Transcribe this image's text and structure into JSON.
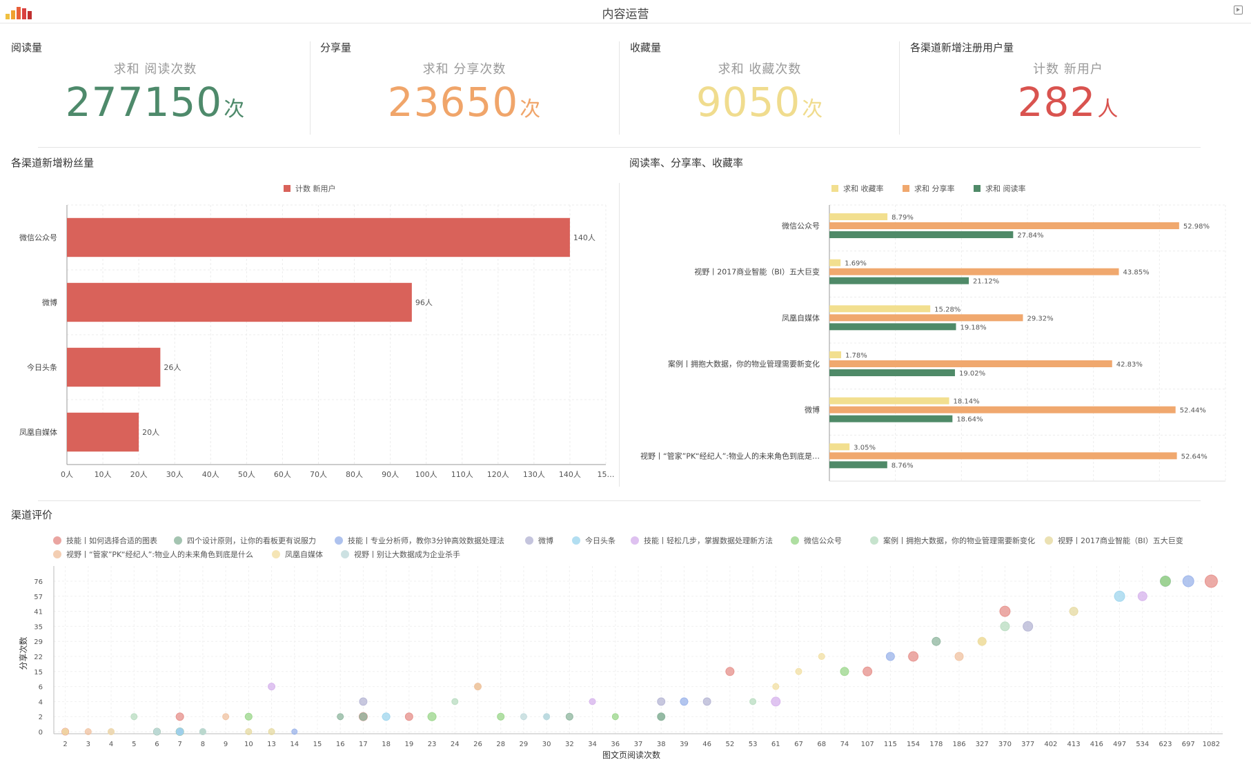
{
  "header": {
    "title": "内容运营"
  },
  "kpis": [
    {
      "label": "阅读量",
      "sub": "求和 阅读次数",
      "value": "277150",
      "unit": "次",
      "color": "#4e8a6b"
    },
    {
      "label": "分享量",
      "sub": "求和 分享次数",
      "value": "23650",
      "unit": "次",
      "color": "#f0a56a"
    },
    {
      "label": "收藏量",
      "sub": "求和 收藏次数",
      "value": "9050",
      "unit": "次",
      "color": "#f0dc8e"
    },
    {
      "label": "各渠道新增注册用户量",
      "sub": "计数 新用户",
      "value": "282",
      "unit": "人",
      "color": "#d9534f"
    }
  ],
  "sections": {
    "fans": "各渠道新增粉丝量",
    "rates": "阅读率、分享率、收藏率",
    "eval": "渠道评价"
  },
  "chart_data": [
    {
      "type": "bar",
      "orientation": "horizontal",
      "title": "各渠道新增粉丝量",
      "legend": [
        "计数 新用户"
      ],
      "color": "#d9625a",
      "categories": [
        "微信公众号",
        "微博",
        "今日头条",
        "凤凰自媒体"
      ],
      "values": [
        140,
        96,
        26,
        20
      ],
      "value_labels": [
        "140人",
        "96人",
        "26人",
        "20人"
      ],
      "xticks": [
        "0人",
        "10人",
        "20人",
        "30人",
        "40人",
        "50人",
        "60人",
        "70人",
        "80人",
        "90人",
        "100人",
        "110人",
        "120人",
        "130人",
        "140人",
        "15…"
      ],
      "xlim": [
        0,
        150
      ]
    },
    {
      "type": "bar",
      "orientation": "horizontal",
      "title": "阅读率、分享率、收藏率",
      "categories": [
        "微信公众号",
        "视野丨2017商业智能（BI）五大巨变",
        "凤凰自媒体",
        "案例丨拥抱大数据，你的物业管理需要新变化",
        "微博",
        "视野丨“管家”PK“经纪人”:物业人的未来角色到底是…"
      ],
      "series": [
        {
          "name": "求和 收藏率",
          "color": "#f2df8f",
          "values": [
            8.79,
            1.69,
            15.28,
            1.78,
            18.14,
            3.05
          ],
          "labels": [
            "8.79%",
            "1.69%",
            "15.28%",
            "1.78%",
            "18.14%",
            "3.05%"
          ]
        },
        {
          "name": "求和 分享率",
          "color": "#f0a86e",
          "values": [
            52.98,
            43.85,
            29.32,
            42.83,
            52.44,
            52.64
          ],
          "labels": [
            "52.98%",
            "43.85%",
            "29.32%",
            "42.83%",
            "52.44%",
            "52.64%"
          ]
        },
        {
          "name": "求和 阅读率",
          "color": "#4f8a68",
          "values": [
            27.84,
            21.12,
            19.18,
            19.02,
            18.64,
            8.76
          ],
          "labels": [
            "27.84%",
            "21.12%",
            "19.18%",
            "19.02%",
            "18.64%",
            "8.76%"
          ]
        }
      ],
      "xlim": [
        0,
        60
      ]
    },
    {
      "type": "scatter",
      "title": "渠道评价",
      "xlabel": "图文页阅读次数",
      "ylabel": "分享次数",
      "xcategories": [
        "2",
        "3",
        "4",
        "5",
        "6",
        "7",
        "8",
        "9",
        "10",
        "13",
        "14",
        "15",
        "16",
        "17",
        "18",
        "19",
        "23",
        "24",
        "26",
        "28",
        "29",
        "30",
        "32",
        "34",
        "36",
        "37",
        "38",
        "39",
        "46",
        "52",
        "53",
        "61",
        "67",
        "68",
        "74",
        "107",
        "115",
        "154",
        "178",
        "186",
        "327",
        "370",
        "377",
        "402",
        "413",
        "416",
        "497",
        "534",
        "623",
        "697",
        "1082"
      ],
      "ycategories": [
        "0",
        "2",
        "4",
        "6",
        "15",
        "22",
        "29",
        "35",
        "41",
        "57",
        "76"
      ],
      "series": [
        {
          "name": "技能丨如何选择合适的图表",
          "color": "#e58f8a",
          "points": [
            [
              0,
              0,
              8
            ],
            [
              5,
              1,
              9
            ],
            [
              13,
              1,
              10
            ],
            [
              15,
              1,
              9
            ],
            [
              29,
              4,
              10
            ],
            [
              35,
              4,
              11
            ],
            [
              37,
              5,
              12
            ],
            [
              41,
              8,
              13
            ],
            [
              50,
              10,
              16
            ]
          ]
        },
        {
          "name": "四个设计原则，让你的看板更有说服力",
          "color": "#8db59d",
          "points": [
            [
              4,
              0,
              8
            ],
            [
              5,
              0,
              9
            ],
            [
              12,
              1,
              7
            ],
            [
              13,
              1,
              9
            ],
            [
              22,
              1,
              8
            ],
            [
              26,
              1,
              9
            ],
            [
              26,
              1,
              8
            ],
            [
              38,
              6,
              10
            ],
            [
              48,
              10,
              13
            ]
          ]
        },
        {
          "name": "技能丨专业分析师，教你3分钟高效数据处理法",
          "color": "#9ab3ea",
          "points": [
            [
              5,
              0,
              7
            ],
            [
              10,
              0,
              6
            ],
            [
              27,
              2,
              9
            ],
            [
              36,
              5,
              10
            ],
            [
              49,
              10,
              14
            ]
          ]
        },
        {
          "name": "微博",
          "color": "#b5b5d4",
          "points": [
            [
              13,
              2,
              9
            ],
            [
              26,
              2,
              9
            ],
            [
              28,
              2,
              9
            ],
            [
              42,
              7,
              12
            ]
          ]
        },
        {
          "name": "今日头条",
          "color": "#9fd6ee",
          "points": [
            [
              5,
              0,
              8
            ],
            [
              14,
              1,
              9
            ],
            [
              21,
              1,
              7
            ],
            [
              46,
              9,
              13
            ]
          ]
        },
        {
          "name": "技能丨轻松几步，掌握数据处理新方法",
          "color": "#d6b2ec",
          "points": [
            [
              2,
              0,
              7
            ],
            [
              6,
              0,
              7
            ],
            [
              9,
              3,
              8
            ],
            [
              23,
              2,
              7
            ],
            [
              31,
              2,
              11
            ],
            [
              47,
              9,
              11
            ]
          ]
        },
        {
          "name": "微信公众号",
          "color": "#9ad68a",
          "points": [
            [
              6,
              0,
              7
            ],
            [
              8,
              1,
              8
            ],
            [
              16,
              1,
              10
            ],
            [
              19,
              1,
              8
            ],
            [
              24,
              1,
              7
            ],
            [
              34,
              4,
              10
            ],
            [
              48,
              10,
              12
            ]
          ]
        },
        {
          "name": "案例丨拥抱大数据，你的物业管理需要新变化",
          "color": "#b8dcc0",
          "points": [
            [
              3,
              1,
              7
            ],
            [
              4,
              0,
              7
            ],
            [
              17,
              2,
              7
            ],
            [
              30,
              2,
              7
            ],
            [
              41,
              7,
              11
            ]
          ]
        },
        {
          "name": "视野丨2017商业智能（BI）五大巨变",
          "color": "#e6d9a0",
          "points": [
            [
              8,
              0,
              7
            ],
            [
              9,
              0,
              7
            ],
            [
              18,
              3,
              7
            ],
            [
              40,
              6,
              10
            ],
            [
              44,
              8,
              10
            ]
          ]
        },
        {
          "name": "视野丨“管家”PK“经纪人”:物业人的未来角色到底是什么",
          "color": "#f0c2a0",
          "points": [
            [
              1,
              0,
              7
            ],
            [
              7,
              1,
              7
            ],
            [
              18,
              3,
              8
            ],
            [
              39,
              5,
              10
            ]
          ]
        },
        {
          "name": "凤凰自媒体",
          "color": "#f2dfa2",
          "points": [
            [
              0,
              0,
              7
            ],
            [
              2,
              0,
              7
            ],
            [
              31,
              3,
              7
            ],
            [
              32,
              4,
              7
            ],
            [
              33,
              5,
              7
            ],
            [
              40,
              6,
              9
            ]
          ]
        },
        {
          "name": "视野丨别让大数据成为企业杀手",
          "color": "#bfd9db",
          "points": [
            [
              4,
              0,
              7
            ],
            [
              6,
              0,
              7
            ],
            [
              20,
              1,
              7
            ],
            [
              21,
              1,
              7
            ]
          ]
        }
      ]
    }
  ]
}
